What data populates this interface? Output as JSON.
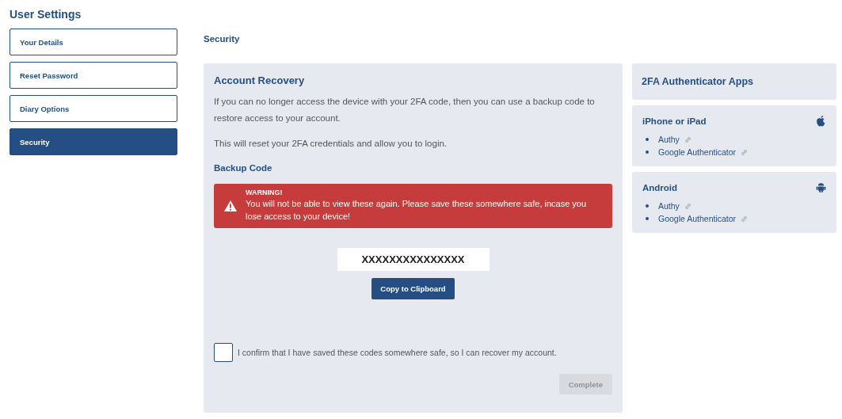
{
  "page_title": "User Settings",
  "sidebar": {
    "items": [
      {
        "label": "Your Details",
        "selected": false
      },
      {
        "label": "Reset Password",
        "selected": false
      },
      {
        "label": "Diary Options",
        "selected": false
      },
      {
        "label": "Security",
        "selected": true
      }
    ]
  },
  "section_title": "Security",
  "recovery": {
    "title": "Account Recovery",
    "paragraphs": [
      "If you can no longer access the device with your 2FA code, then you can use a backup code to restore access to your account.",
      "This will reset your 2FA credentials and allow you to login."
    ],
    "backup_heading": "Backup Code",
    "warning": {
      "title": "WARNING!",
      "text": "You will not be able to view these again. Please save these somewhere safe, incase you lose access to your device!"
    },
    "code": "XXXXXXXXXXXXXXX",
    "copy_button": "Copy to Clipboard",
    "confirm": {
      "label": "I confirm that I have saved these codes somewhere safe, so I can recover my account.",
      "checked": false
    },
    "complete_button": {
      "label": "Complete",
      "disabled": true
    }
  },
  "apps": {
    "title": "2FA Authenticator Apps",
    "platforms": [
      {
        "name": "iPhone or iPad",
        "kind": "apple",
        "apps": [
          "Authy",
          "Google Authenticator"
        ]
      },
      {
        "name": "Android",
        "kind": "android",
        "apps": [
          "Authy",
          "Google Authenticator"
        ]
      }
    ]
  }
}
